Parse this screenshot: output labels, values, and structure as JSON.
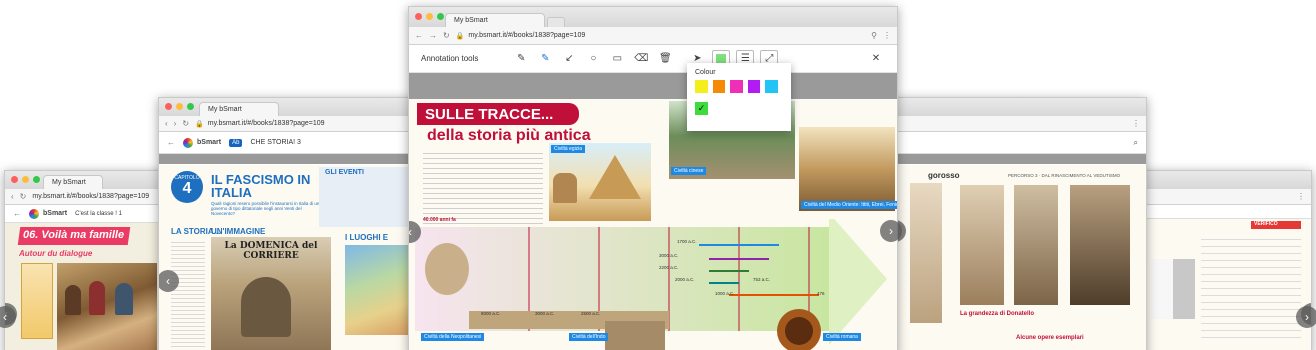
{
  "left_window": {
    "tab_title": "My bSmart",
    "url": "my.bsmart.it/#/books/1838?page=109",
    "app_name": "bSmart",
    "class_label": "C'est la classe ! 1",
    "page_title": "06. Voilà ma famille",
    "subtitle": "Autour du dialogue"
  },
  "middle_window": {
    "tab_title": "My bSmart",
    "url": "my.bsmart.it/#/books/1838?page=109",
    "app_name": "bSmart",
    "book_badge": "Ab",
    "book_title": "CHE STORIA! 3",
    "chapter_label": "CAPITOLO",
    "chapter_number": "4",
    "chapter_title": "IL FASCISMO IN ITALIA",
    "chapter_intro": "Quali ragioni resero possibile l'instaurarsi in Italia di un governo di tipo dittatoriale negli anni Venti del Novecento?",
    "section_story": "LA STORIA...",
    "section_image": "UN'IMMAGINE",
    "newspaper": "La DOMENICA del CORRIERE",
    "events_label": "GLI EVENTI",
    "places_label": "I LUOGHI E"
  },
  "front_window": {
    "tab_title": "My bSmart",
    "url": "my.bsmart.it/#/books/1838?page=109",
    "toolbar_title": "Annotation tools",
    "colour_label": "Colour",
    "colours": [
      "#f4ef1c",
      "#f58a07",
      "#ef2fb5",
      "#b21cf2",
      "#22c4f5",
      "#3ddc3d"
    ],
    "page_heading_1": "SULLE TRACCE...",
    "page_heading_2": "della storia più antica",
    "caption_egypt": "Civiltà egizia",
    "caption_china": "Civiltà cinese",
    "caption_med": "Civiltà del Medio Oriente: Ittiti, Ebrei, Fenici",
    "caption_neo": "Civiltà della Neopolitanesi",
    "caption_indo": "Civiltà dell'Indo",
    "caption_rome": "Civiltà romana",
    "timeline_label": "40.000 anni fa",
    "timeline_dates": [
      "1700 a.C.",
      "3000 a.C.",
      "2200 a.C.",
      "2000 a.C.",
      "1000 a.C.",
      "753 a.C.",
      "476",
      "8000 a.C.",
      "3000 a.C.",
      "2500 a.C."
    ]
  },
  "right_window": {
    "header_left": "gorosso",
    "header_right": "PERCORSO 3 · DAL RINASCIMENTO AL VEDUTISMO",
    "caption_1": "La grandezza di Donatello",
    "caption_2": "Alcune opere esemplari",
    "verify_label": "VERIFICO"
  },
  "theme": {
    "window_border": "#c9c9c9",
    "accent_red": "#c0103a",
    "accent_blue": "#1565c0",
    "page_grey": "#9a9a9a"
  }
}
